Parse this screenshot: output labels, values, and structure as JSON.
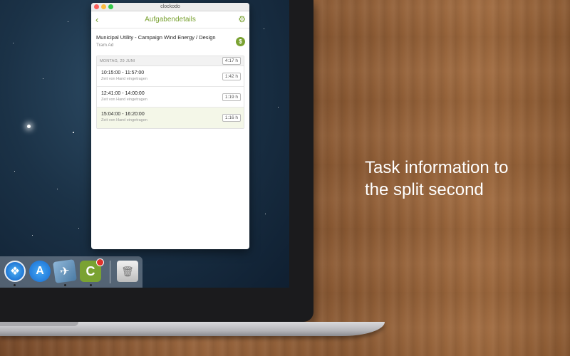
{
  "window": {
    "title": "clockodo"
  },
  "nav": {
    "title": "Aufgabendetails",
    "back_icon": "chevron-left-icon",
    "settings_icon": "gear-icon"
  },
  "task": {
    "title": "Municipal Utility - Campaign Wind Energy / Design",
    "subtitle": "Tram Ad",
    "billable_icon": "dollar-icon",
    "billable_symbol": "$"
  },
  "day": {
    "label": "MONTAG, 29 JUNI",
    "total": "4:17 h",
    "entries": [
      {
        "time": "10:15:00 - 11:57:00",
        "note": "Zeit von Hand eingetragen",
        "duration": "1:42 h"
      },
      {
        "time": "12:41:00 - 14:00:00",
        "note": "Zeit von Hand eingetragen",
        "duration": "1:19 h"
      },
      {
        "time": "15:04:00 - 16:20:00",
        "note": "Zeit von Hand eingetragen",
        "duration": "1:16 h"
      }
    ]
  },
  "tagline": {
    "line1": "Task information to",
    "line2": "the split second"
  },
  "colors": {
    "accent": "#7aa232",
    "close": "#fc605c",
    "minimize": "#fdbc40",
    "zoom": "#34c84a"
  },
  "dock": {
    "icons": [
      "safari-icon",
      "app-store-icon",
      "preview-icon",
      "clockodo-icon",
      "trash-icon"
    ]
  }
}
